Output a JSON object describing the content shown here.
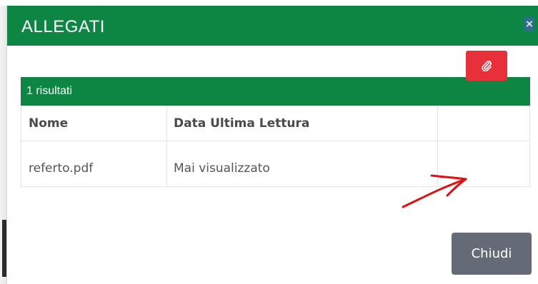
{
  "modal": {
    "title": "ALLEGATI",
    "close_icon": "close-icon",
    "close_symbol": "×"
  },
  "results": {
    "summary": "1 risultati",
    "columns": [
      "Nome",
      "Data Ultima Lettura",
      ""
    ],
    "rows": [
      {
        "name": "referto.pdf",
        "last_read": "Mai visualizzato",
        "action_icon": "paperclip-icon"
      }
    ]
  },
  "footer": {
    "close_label": "Chiudi"
  },
  "colors": {
    "header_green": "#0d8644",
    "attach_red": "#e8303b",
    "footer_button": "#646b77",
    "annotation_arrow": "#e01010"
  }
}
